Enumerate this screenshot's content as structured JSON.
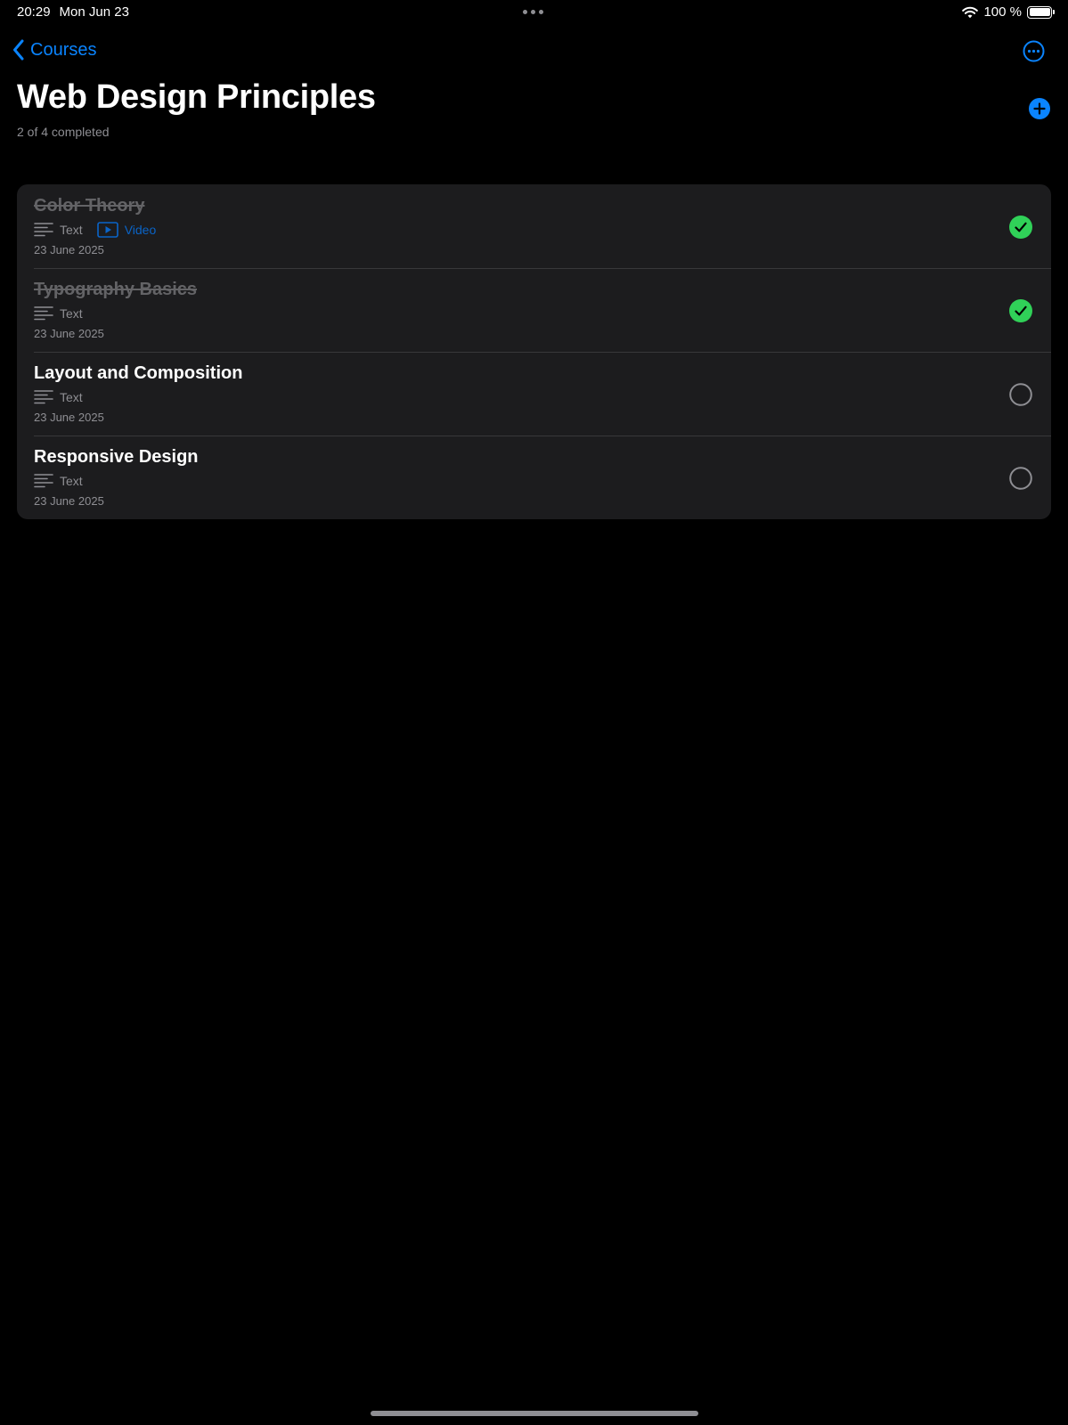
{
  "status_bar": {
    "time": "20:29",
    "date": "Mon Jun 23",
    "battery": "100 %"
  },
  "nav": {
    "back_label": "Courses"
  },
  "header": {
    "title": "Web Design Principles",
    "subtitle": "2 of 4 completed"
  },
  "lessons": [
    {
      "title": "Color Theory",
      "completed": true,
      "types": [
        {
          "label": "Text",
          "kind": "text"
        },
        {
          "label": "Video",
          "kind": "video"
        }
      ],
      "date": "23 June 2025"
    },
    {
      "title": "Typography Basics",
      "completed": true,
      "types": [
        {
          "label": "Text",
          "kind": "text"
        }
      ],
      "date": "23 June 2025"
    },
    {
      "title": "Layout and Composition",
      "completed": false,
      "types": [
        {
          "label": "Text",
          "kind": "text"
        }
      ],
      "date": "23 June 2025"
    },
    {
      "title": "Responsive Design",
      "completed": false,
      "types": [
        {
          "label": "Text",
          "kind": "text"
        }
      ],
      "date": "23 June 2025"
    }
  ],
  "colors": {
    "accent": "#0a84ff",
    "complete": "#30d158",
    "background": "#000000",
    "card": "#1c1c1e"
  },
  "icons": {
    "back": "chevron-left-icon",
    "more": "ellipsis-circle-icon",
    "add": "plus-circle-icon",
    "text": "text-lines-icon",
    "video": "play-rectangle-icon",
    "complete": "checkmark-circle-icon",
    "incomplete": "empty-circle-icon"
  }
}
